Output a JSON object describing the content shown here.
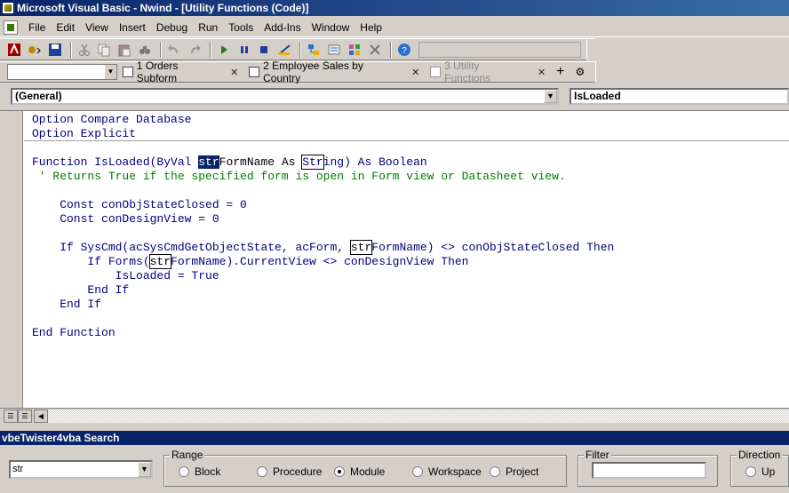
{
  "window": {
    "title": "Microsoft Visual Basic - Nwind - [Utility Functions (Code)]"
  },
  "menubar": {
    "items": [
      {
        "label": "File",
        "hot": "F"
      },
      {
        "label": "Edit",
        "hot": "E"
      },
      {
        "label": "View",
        "hot": "V"
      },
      {
        "label": "Insert",
        "hot": "I"
      },
      {
        "label": "Debug",
        "hot": "D"
      },
      {
        "label": "Run",
        "hot": "R"
      },
      {
        "label": "Tools",
        "hot": "T"
      },
      {
        "label": "Add-Ins",
        "hot": "A"
      },
      {
        "label": "Window",
        "hot": "W"
      },
      {
        "label": "Help",
        "hot": "H"
      }
    ]
  },
  "toolbar": {
    "icons": [
      "view-access-icon",
      "insert-module-icon",
      "save-icon",
      "cut-icon",
      "copy-icon",
      "paste-icon",
      "find-icon",
      "undo-icon",
      "redo-icon",
      "run-icon",
      "break-icon",
      "reset-icon",
      "design-mode-icon",
      "project-explorer-icon",
      "properties-icon",
      "object-browser-icon",
      "toolbox-icon",
      "help-icon"
    ]
  },
  "tabs": [
    {
      "label": "1 Orders Subform",
      "active": false
    },
    {
      "label": "2 Employee Sales by Country",
      "active": false
    },
    {
      "label": "3 Utility Functions",
      "active": true
    }
  ],
  "code_window": {
    "object_combo": "(General)",
    "procedure_combo": "IsLoaded"
  },
  "code": {
    "line1": "Option Compare Database",
    "line2": "Option Explicit",
    "fn_decl_a": "Function IsLoaded(ByVal ",
    "fn_decl_hl": "str",
    "fn_decl_b": "FormName As ",
    "fn_decl_box": "Str",
    "fn_decl_c": "ing) As Boolean",
    "comment": " ' Returns True if the specified form is open in Form view or Datasheet view.",
    "const1": "    Const conObjStateClosed = 0",
    "const2": "    Const conDesignView = 0",
    "if1_a": "    If SysCmd(acSysCmdGetObjectState, acForm, ",
    "if1_box": "str",
    "if1_b": "FormName) <> conObjStateClosed Then",
    "if2_a": "        If Forms(",
    "if2_box": "str",
    "if2_b": "FormName).CurrentView <> conDesignView Then",
    "assign": "            IsLoaded = True",
    "endif1": "        End If",
    "endif2": "    End If",
    "endfn": "End Function"
  },
  "search_panel": {
    "title": "vbeTwister4vba Search",
    "query": "str",
    "range_label": "Range",
    "range_options": [
      {
        "label": "Block",
        "checked": false
      },
      {
        "label": "Procedure",
        "checked": false
      },
      {
        "label": "Module",
        "checked": true
      },
      {
        "label": "Workspace",
        "checked": false
      },
      {
        "label": "Project",
        "checked": false
      }
    ],
    "filter_label": "Filter",
    "filter_value": "",
    "direction_label": "Direction",
    "direction_option": "Up"
  }
}
